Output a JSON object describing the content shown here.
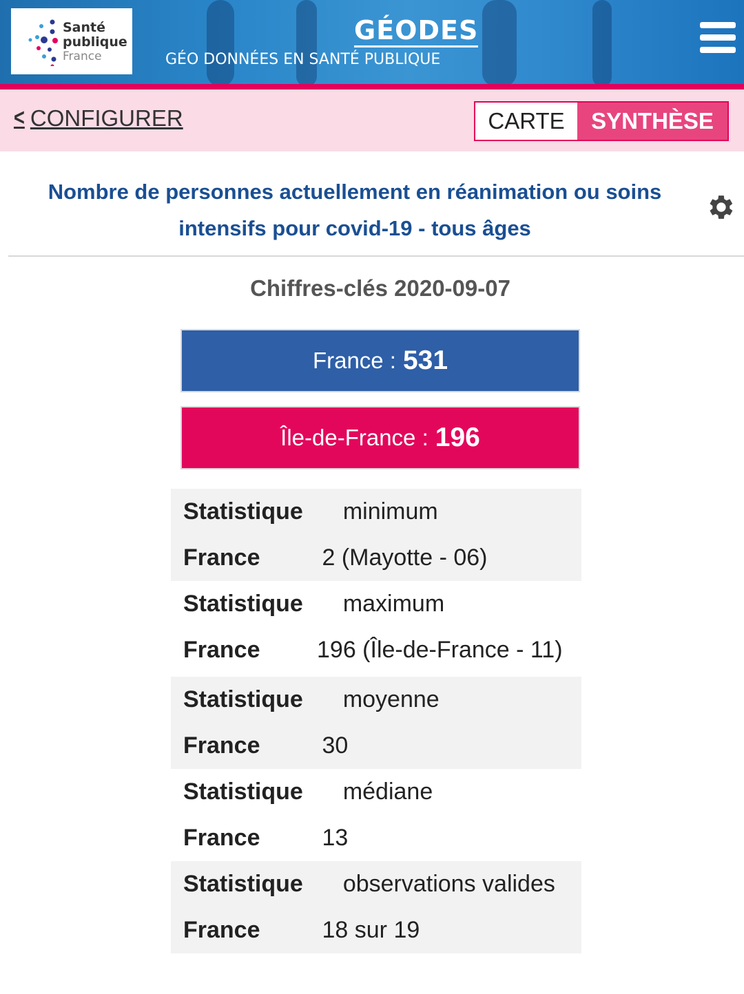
{
  "header": {
    "logo_lines": [
      "Santé",
      "publique",
      "France"
    ],
    "title": "GÉODES",
    "subtitle": "GÉO DONNÉES EN SANTÉ PUBLIQUE",
    "menu_icon": "hamburger-menu-icon"
  },
  "toolbar": {
    "back_label": "CONFIGURER",
    "tabs": [
      {
        "label": "CARTE",
        "active": false
      },
      {
        "label": "SYNTHÈSE",
        "active": true
      }
    ]
  },
  "indicator": {
    "title": "Nombre de personnes actuellement en réanimation ou soins intensifs pour covid-19 - tous âges",
    "settings_icon": "gear-icon"
  },
  "key_figures": {
    "title": "Chiffres-clés 2020-09-07",
    "items": [
      {
        "label": "France : ",
        "value": "531",
        "color": "#2e5fa7"
      },
      {
        "label": "Île-de-France : ",
        "value": "196",
        "color": "#e3075c"
      }
    ]
  },
  "stats": [
    {
      "stat_label": "Statistique",
      "stat_value": "minimum",
      "region_label": "France",
      "region_value": "2 (Mayotte - 06)"
    },
    {
      "stat_label": "Statistique",
      "stat_value": "maximum",
      "region_label": "France",
      "region_value": "196 (Île-de-France - 11)"
    },
    {
      "stat_label": "Statistique",
      "stat_value": "moyenne",
      "region_label": "France",
      "region_value": "30"
    },
    {
      "stat_label": "Statistique",
      "stat_value": "médiane",
      "region_label": "France",
      "region_value": "13"
    },
    {
      "stat_label": "Statistique",
      "stat_value": "observations valides",
      "region_label": "France",
      "region_value": "18 sur 19"
    }
  ],
  "colors": {
    "brand_blue": "#1a4f93",
    "accent_pink": "#e5005b",
    "toolbar_pink": "#fadbe6"
  }
}
